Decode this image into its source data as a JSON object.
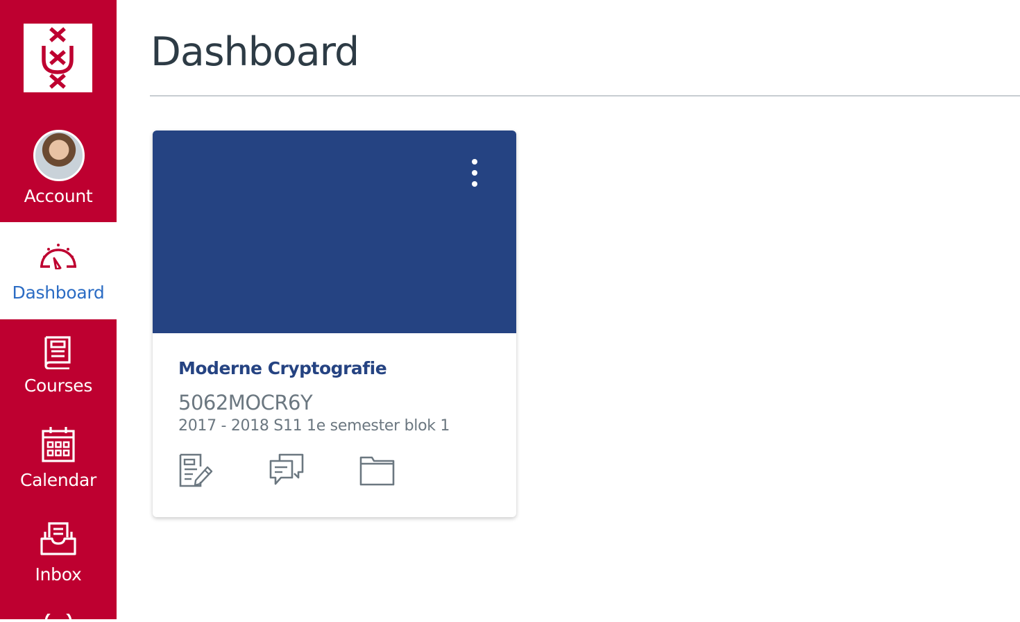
{
  "sidebar": {
    "logo": "uva-logo",
    "items": [
      {
        "label": "Account",
        "icon": "avatar"
      },
      {
        "label": "Dashboard",
        "icon": "dashboard-icon",
        "active": true
      },
      {
        "label": "Courses",
        "icon": "courses-icon"
      },
      {
        "label": "Calendar",
        "icon": "calendar-icon"
      },
      {
        "label": "Inbox",
        "icon": "inbox-icon"
      }
    ]
  },
  "main": {
    "title": "Dashboard",
    "cards": [
      {
        "title": "Moderne Cryptografie",
        "code": "5062MOCR6Y",
        "term": "2017 - 2018 S11 1e semester blok 1",
        "hero_color": "#254382",
        "actions": [
          "assignments-icon",
          "discussions-icon",
          "files-icon"
        ]
      }
    ]
  },
  "colors": {
    "brand": "#be0030",
    "active_link": "#2b6cc4",
    "title_text": "#2d3b45",
    "muted_text": "#6b7780"
  }
}
